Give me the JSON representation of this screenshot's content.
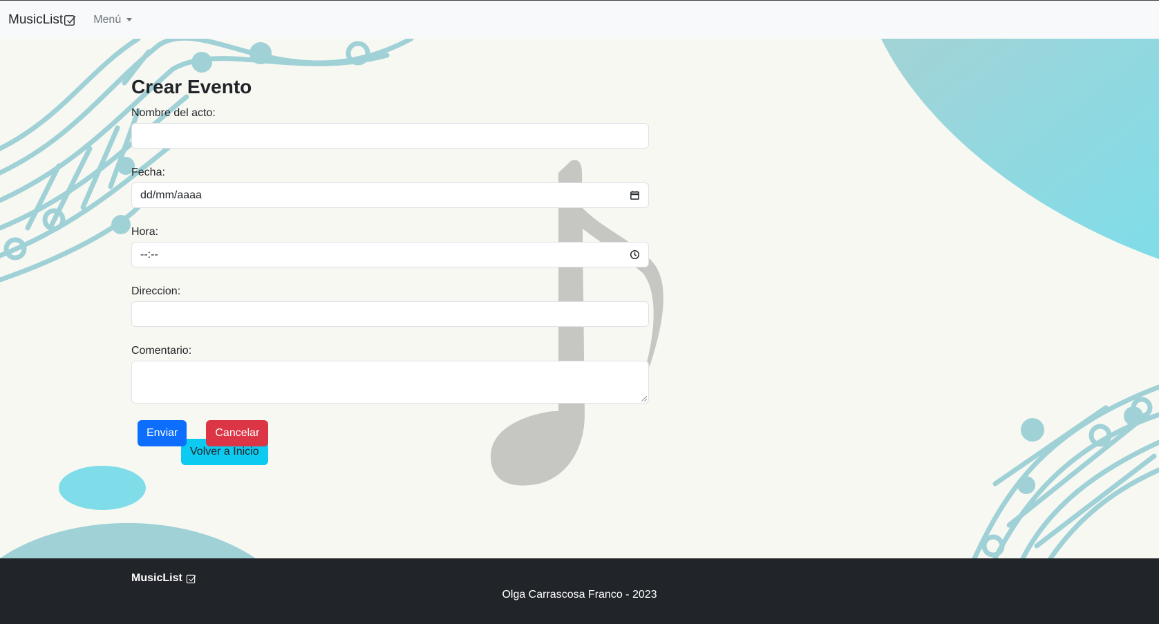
{
  "navbar": {
    "brand": "MusicList",
    "menu_label": "Menú"
  },
  "form": {
    "title": "Crear Evento",
    "fields": {
      "nombre": {
        "label": "Nombre del acto:",
        "value": ""
      },
      "fecha": {
        "label": "Fecha:",
        "placeholder": "dd/mm/aaaa"
      },
      "hora": {
        "label": "Hora:",
        "placeholder": "--:--"
      },
      "direccion": {
        "label": "Direccion:",
        "value": ""
      },
      "comentario": {
        "label": "Comentario:",
        "value": ""
      }
    },
    "submit_label": "Enviar",
    "cancel_label": "Cancelar",
    "home_label": "Volver a Inicio"
  },
  "footer": {
    "brand": "MusicList",
    "credit": "Olga Carrascosa Franco - 2023"
  },
  "colors": {
    "primary": "#0d6efd",
    "danger": "#dc3545",
    "info": "#0dcaf0",
    "footer_bg": "#212529",
    "teal": "#9fd1d6",
    "cyan": "#7fdde9"
  }
}
